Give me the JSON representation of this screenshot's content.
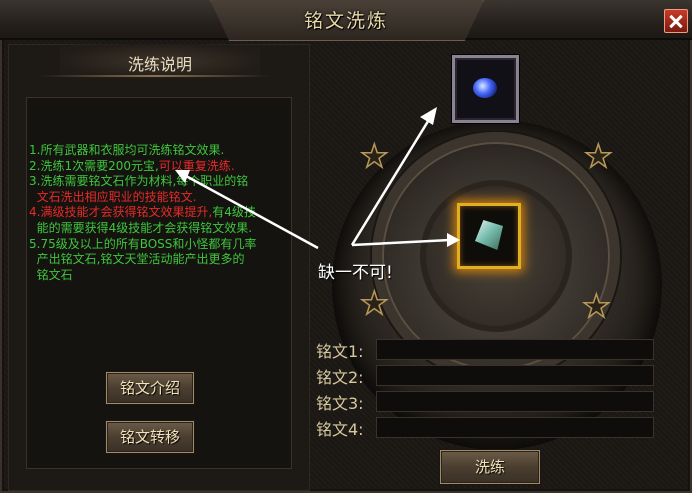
{
  "window": {
    "title": "铭文洗炼"
  },
  "left": {
    "subtitle": "洗练说明",
    "lines": [
      {
        "parts": [
          {
            "text": "1.所有武器和衣服均可洗练铭文效果.",
            "red": false
          }
        ]
      },
      {
        "parts": [
          {
            "text": "2.洗练1次需要200元宝,",
            "red": false
          },
          {
            "text": "可以重复洗练.",
            "red": true
          }
        ]
      },
      {
        "parts": [
          {
            "text": "3.洗练需要铭文石作为材料,",
            "red": false
          },
          {
            "text": "每个职业的铭",
            "red": false
          }
        ]
      },
      {
        "parts": [
          {
            "text": "  文石洗出相应职业的技能铭文.",
            "red": true
          }
        ]
      },
      {
        "parts": [
          {
            "text": "4.满级技能才会获得铭文效果提升,",
            "red": true
          },
          {
            "text": "有4级技",
            "red": false
          }
        ]
      },
      {
        "parts": [
          {
            "text": "  能的需要获得4级技能才会获得铭文效果.",
            "red": false
          }
        ]
      },
      {
        "parts": [
          {
            "text": "5.75级及以上的所有BOSS和小怪都有几率",
            "red": false
          }
        ]
      },
      {
        "parts": [
          {
            "text": "  产出铭文石,铭文天堂活动能产出更多的",
            "red": false
          }
        ]
      },
      {
        "parts": [
          {
            "text": "  铭文石",
            "red": false
          }
        ]
      }
    ],
    "btn_intro": "铭文介绍",
    "btn_transfer": "铭文转移"
  },
  "right": {
    "slots": [
      {
        "label": "铭文1:",
        "value": ""
      },
      {
        "label": "铭文2:",
        "value": ""
      },
      {
        "label": "铭文3:",
        "value": ""
      },
      {
        "label": "铭文4:",
        "value": ""
      }
    ],
    "btn_refine": "洗练",
    "annotation": "缺一不可!"
  },
  "icons": {
    "close": "close-icon",
    "star": "star-icon",
    "top_item": "gem-icon",
    "center_item": "inscription-stone-icon"
  },
  "colors": {
    "green_text": "#3ec63e",
    "red_text": "#e62a2a",
    "gold_glow": "#e0b020"
  }
}
